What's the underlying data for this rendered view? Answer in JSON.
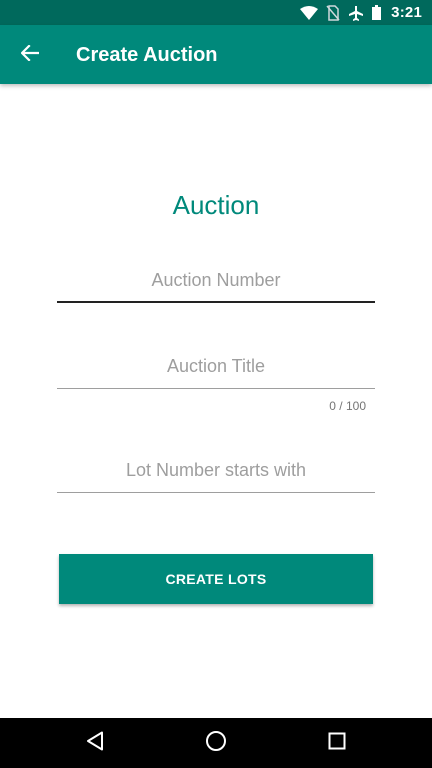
{
  "status_bar": {
    "time": "3:21",
    "icons": [
      "wifi-icon",
      "no-sim-icon",
      "airplane-mode-icon",
      "battery-icon"
    ]
  },
  "app_bar": {
    "title": "Create Auction",
    "back_icon": "arrow-back-icon"
  },
  "form": {
    "heading": "Auction",
    "auction_number": {
      "placeholder": "Auction Number",
      "value": ""
    },
    "auction_title": {
      "placeholder": "Auction Title",
      "value": "",
      "counter": "0 / 100"
    },
    "lot_start": {
      "placeholder": "Lot Number starts with",
      "value": ""
    },
    "submit_label": "CREATE LOTS"
  },
  "nav_bar": {
    "icons": [
      "back-triangle-icon",
      "home-circle-icon",
      "recents-square-icon"
    ]
  },
  "colors": {
    "primary": "#00897b",
    "primary_dark": "#00695c",
    "hint": "#9e9e9e"
  }
}
